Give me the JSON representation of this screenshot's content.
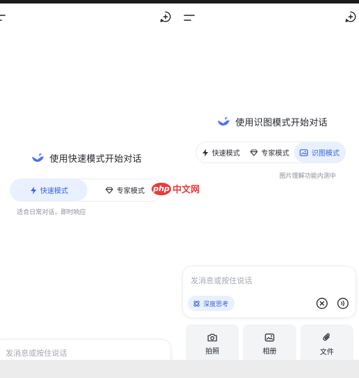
{
  "left": {
    "welcome": "使用快速模式开始对话",
    "modes": [
      {
        "label": "快速模式",
        "icon": "lightning-icon",
        "active": true
      },
      {
        "label": "专家模式",
        "icon": "diamond-icon",
        "active": false
      }
    ],
    "mode_hint": "适合日常对话，即时响应",
    "input_placeholder": "发消息或按住说话"
  },
  "right": {
    "welcome": "使用识图模式开始对话",
    "modes": [
      {
        "label": "快速模式",
        "icon": "lightning-icon",
        "active": false
      },
      {
        "label": "专家模式",
        "icon": "diamond-icon",
        "active": false
      },
      {
        "label": "识图模式",
        "icon": "image-icon",
        "active": true
      }
    ],
    "mode_hint": "图片理解功能内测中",
    "input_placeholder": "发消息或按住说话",
    "deep_think": "深度思考",
    "attachments": [
      {
        "label": "拍照",
        "icon": "camera-icon"
      },
      {
        "label": "相册",
        "icon": "album-icon"
      },
      {
        "label": "文件",
        "icon": "paperclip-icon"
      }
    ]
  },
  "watermark": {
    "badge": "php",
    "text": "中文网"
  },
  "colors": {
    "accent": "#3667d8",
    "accent_bg": "#e9f0ff",
    "whale": "#4d6bfe",
    "watermark": "#e93a3a"
  }
}
